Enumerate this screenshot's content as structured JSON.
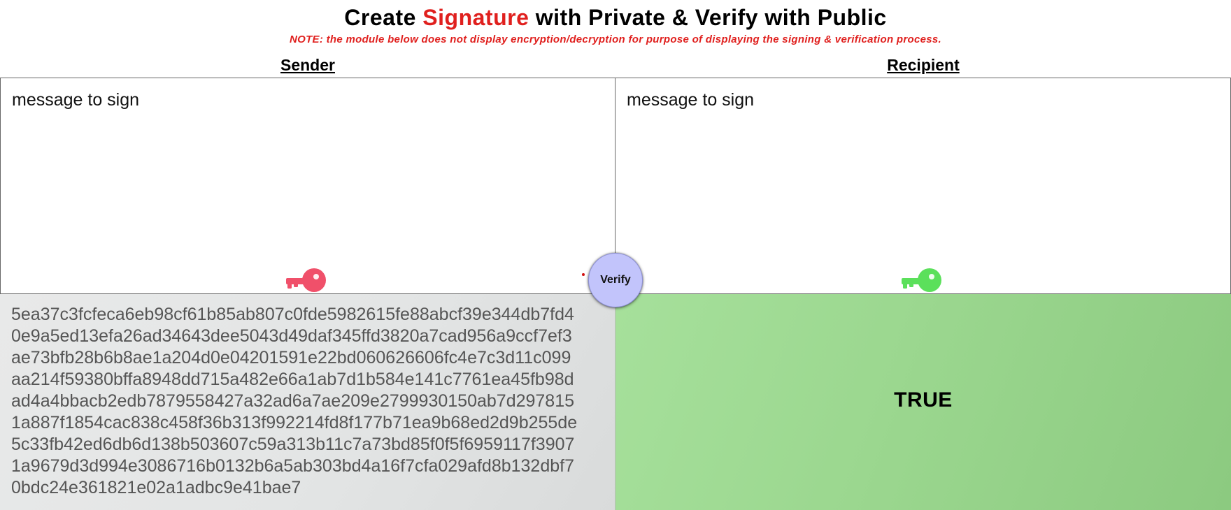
{
  "header": {
    "title_prefix": "Create",
    "title_accent": "Signature",
    "title_suffix": "with Private & Verify with Public",
    "note": "NOTE: the module below does not display encryption/decryption for purpose of displaying the signing & verification process."
  },
  "columns": {
    "sender_label": "Sender",
    "recipient_label": "Recipient"
  },
  "sender": {
    "message": "message to sign",
    "key_icon": "private-key-icon",
    "key_color": "#f0506a",
    "signature_lines": [
      "5ea37c3fcfeca6eb98cf61b85ab807c0fde5982615fe88abcf39e344db7fd4",
      "0e9a5ed13efa26ad34643dee5043d49daf345ffd3820a7cad956a9ccf7ef3",
      "ae73bfb28b6b8ae1a204d0e04201591e22bd060626606fc4e7c3d11c099",
      "aa214f59380bffa8948dd715a482e66a1ab7d1b584e141c7761ea45fb98d",
      "ad4a4bbacb2edb7879558427a32ad6a7ae209e2799930150ab7d297815",
      "1a887f1854cac838c458f36b313f992214fd8f177b71ea9b68ed2d9b255de",
      "5c33fb42ed6db6d138b503607c59a313b11c7a73bd85f0f5f6959117f3907",
      "1a9679d3d994e3086716b0132b6a5ab303bd4a16f7cfa029afd8b132dbf7",
      "0bdc24e361821e02a1adbc9e41bae7"
    ]
  },
  "recipient": {
    "message": "message to sign",
    "key_icon": "public-key-icon",
    "key_color": "#5be05b",
    "result": "TRUE"
  },
  "verify_button": {
    "label": "Verify",
    "color": "#c2c4fb"
  },
  "colors": {
    "accent_red": "#e0201e",
    "result_green": "#9bd78f"
  }
}
